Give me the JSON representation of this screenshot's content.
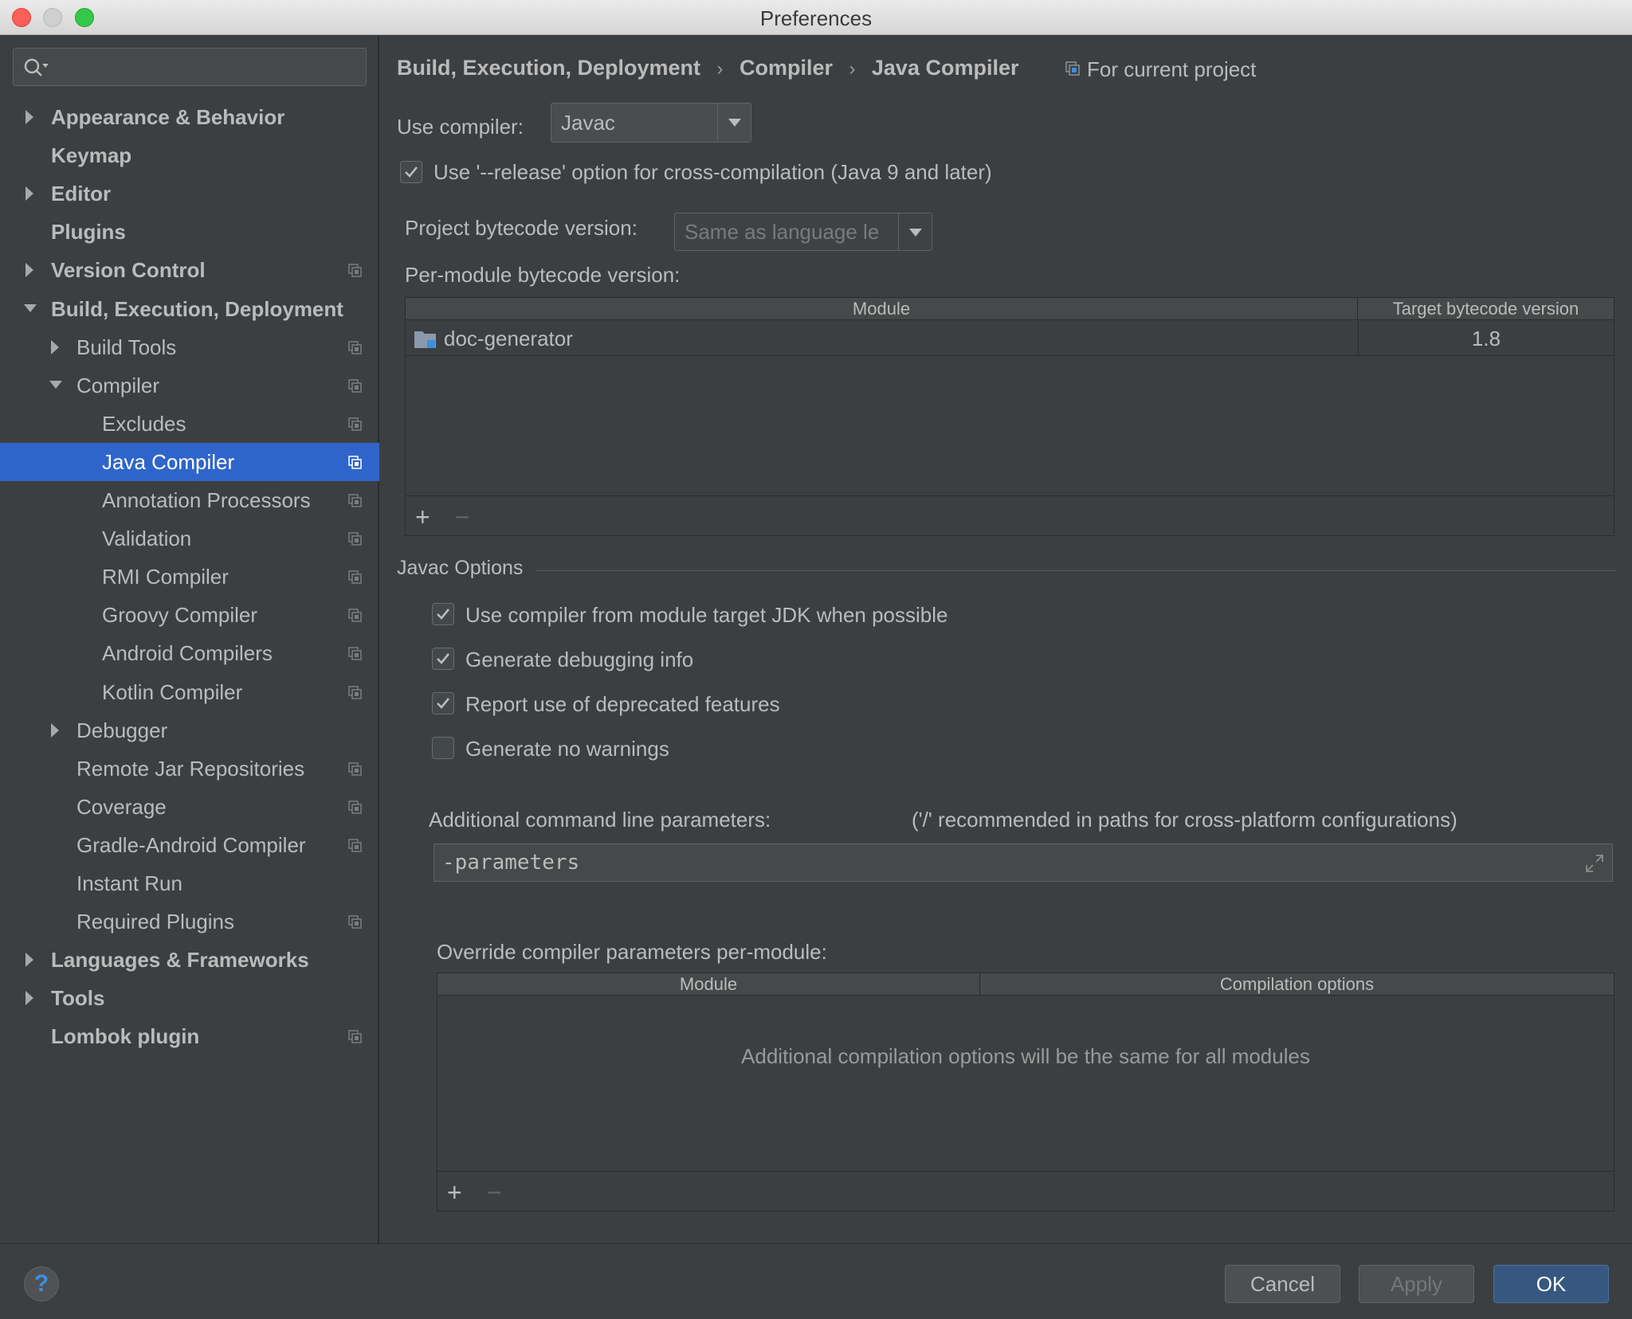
{
  "window": {
    "title": "Preferences"
  },
  "sidebar": {
    "items": [
      {
        "label": "Appearance & Behavior",
        "bold": true,
        "level": 0,
        "arrow": "right",
        "proj": false
      },
      {
        "label": "Keymap",
        "bold": true,
        "level": 0,
        "arrow": "none",
        "proj": false
      },
      {
        "label": "Editor",
        "bold": true,
        "level": 0,
        "arrow": "right",
        "proj": false
      },
      {
        "label": "Plugins",
        "bold": true,
        "level": 0,
        "arrow": "none",
        "proj": false
      },
      {
        "label": "Version Control",
        "bold": true,
        "level": 0,
        "arrow": "right",
        "proj": true
      },
      {
        "label": "Build, Execution, Deployment",
        "bold": true,
        "level": 0,
        "arrow": "down",
        "proj": false
      },
      {
        "label": "Build Tools",
        "bold": false,
        "level": 1,
        "arrow": "right",
        "proj": true
      },
      {
        "label": "Compiler",
        "bold": false,
        "level": 1,
        "arrow": "down",
        "proj": true
      },
      {
        "label": "Excludes",
        "bold": false,
        "level": 2,
        "arrow": "none",
        "proj": true
      },
      {
        "label": "Java Compiler",
        "bold": false,
        "level": 2,
        "arrow": "none",
        "proj": true,
        "selected": true
      },
      {
        "label": "Annotation Processors",
        "bold": false,
        "level": 2,
        "arrow": "none",
        "proj": true
      },
      {
        "label": "Validation",
        "bold": false,
        "level": 2,
        "arrow": "none",
        "proj": true
      },
      {
        "label": "RMI Compiler",
        "bold": false,
        "level": 2,
        "arrow": "none",
        "proj": true
      },
      {
        "label": "Groovy Compiler",
        "bold": false,
        "level": 2,
        "arrow": "none",
        "proj": true
      },
      {
        "label": "Android Compilers",
        "bold": false,
        "level": 2,
        "arrow": "none",
        "proj": true
      },
      {
        "label": "Kotlin Compiler",
        "bold": false,
        "level": 2,
        "arrow": "none",
        "proj": true
      },
      {
        "label": "Debugger",
        "bold": false,
        "level": 1,
        "arrow": "right",
        "proj": false
      },
      {
        "label": "Remote Jar Repositories",
        "bold": false,
        "level": 1,
        "arrow": "none",
        "proj": true
      },
      {
        "label": "Coverage",
        "bold": false,
        "level": 1,
        "arrow": "none",
        "proj": true
      },
      {
        "label": "Gradle-Android Compiler",
        "bold": false,
        "level": 1,
        "arrow": "none",
        "proj": true
      },
      {
        "label": "Instant Run",
        "bold": false,
        "level": 1,
        "arrow": "none",
        "proj": false
      },
      {
        "label": "Required Plugins",
        "bold": false,
        "level": 1,
        "arrow": "none",
        "proj": true
      },
      {
        "label": "Languages & Frameworks",
        "bold": true,
        "level": 0,
        "arrow": "right",
        "proj": false
      },
      {
        "label": "Tools",
        "bold": true,
        "level": 0,
        "arrow": "right",
        "proj": false
      },
      {
        "label": "Lombok plugin",
        "bold": true,
        "level": 0,
        "arrow": "none",
        "proj": true
      }
    ]
  },
  "breadcrumb": {
    "parts": [
      "Build, Execution, Deployment",
      "Compiler",
      "Java Compiler"
    ],
    "separator": "›",
    "scope": "For current project"
  },
  "compiler": {
    "use_compiler_label": "Use compiler:",
    "use_compiler_value": "Javac",
    "release_option_label": "Use '--release' option for cross-compilation (Java 9 and later)",
    "release_option_checked": true,
    "project_bytecode_label": "Project bytecode version:",
    "project_bytecode_value": "Same as language le",
    "per_module_label": "Per-module bytecode version:"
  },
  "bytecode_table": {
    "headers": [
      "Module",
      "Target bytecode version"
    ],
    "rows": [
      {
        "module": "doc-generator",
        "version": "1.8"
      }
    ],
    "add": "+",
    "remove": "−"
  },
  "javac": {
    "section_title": "Javac Options",
    "options": [
      {
        "label": "Use compiler from module target JDK when possible",
        "checked": true
      },
      {
        "label": "Generate debugging info",
        "checked": true
      },
      {
        "label": "Report use of deprecated features",
        "checked": true
      },
      {
        "label": "Generate no warnings",
        "checked": false
      }
    ],
    "params_label": "Additional command line parameters:",
    "params_hint": "('/' recommended in paths for cross-platform configurations)",
    "params_value": "-parameters"
  },
  "override_table": {
    "label": "Override compiler parameters per-module:",
    "headers": [
      "Module",
      "Compilation options"
    ],
    "empty_text": "Additional compilation options will be the same for all modules",
    "add": "+",
    "remove": "−"
  },
  "footer": {
    "help": "?",
    "cancel": "Cancel",
    "apply": "Apply",
    "ok": "OK"
  }
}
